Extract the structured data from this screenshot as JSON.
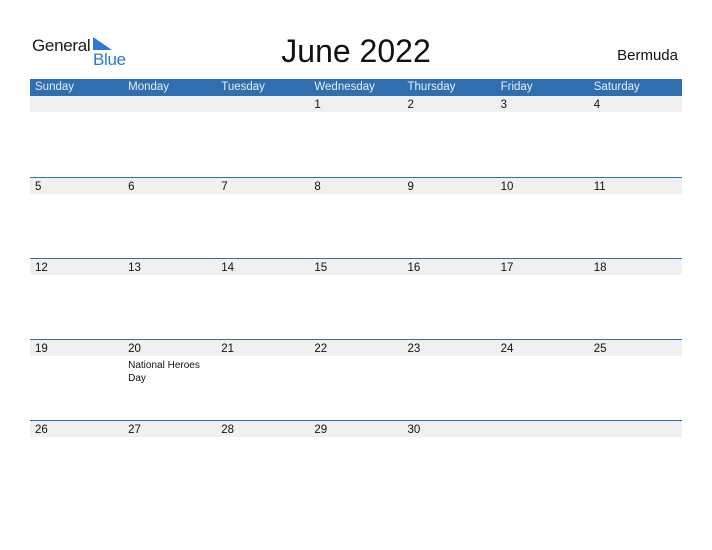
{
  "logo": {
    "word1": "General",
    "word2": "Blue",
    "accent_color": "#2a7ad5"
  },
  "title": "June 2022",
  "country": "Bermuda",
  "colors": {
    "header_bg": "#2f6fb0",
    "row_band": "#f0f0f0"
  },
  "weekdays": [
    "Sunday",
    "Monday",
    "Tuesday",
    "Wednesday",
    "Thursday",
    "Friday",
    "Saturday"
  ],
  "weeks": [
    {
      "days": [
        {
          "d": ""
        },
        {
          "d": ""
        },
        {
          "d": ""
        },
        {
          "d": "1"
        },
        {
          "d": "2"
        },
        {
          "d": "3"
        },
        {
          "d": "4"
        }
      ]
    },
    {
      "days": [
        {
          "d": "5"
        },
        {
          "d": "6"
        },
        {
          "d": "7"
        },
        {
          "d": "8"
        },
        {
          "d": "9"
        },
        {
          "d": "10"
        },
        {
          "d": "11"
        }
      ]
    },
    {
      "days": [
        {
          "d": "12"
        },
        {
          "d": "13"
        },
        {
          "d": "14"
        },
        {
          "d": "15"
        },
        {
          "d": "16"
        },
        {
          "d": "17"
        },
        {
          "d": "18"
        }
      ]
    },
    {
      "days": [
        {
          "d": "19"
        },
        {
          "d": "20",
          "holiday": "National Heroes Day"
        },
        {
          "d": "21"
        },
        {
          "d": "22"
        },
        {
          "d": "23"
        },
        {
          "d": "24"
        },
        {
          "d": "25"
        }
      ]
    },
    {
      "days": [
        {
          "d": "26"
        },
        {
          "d": "27"
        },
        {
          "d": "28"
        },
        {
          "d": "29"
        },
        {
          "d": "30"
        },
        {
          "d": ""
        },
        {
          "d": ""
        }
      ]
    }
  ]
}
